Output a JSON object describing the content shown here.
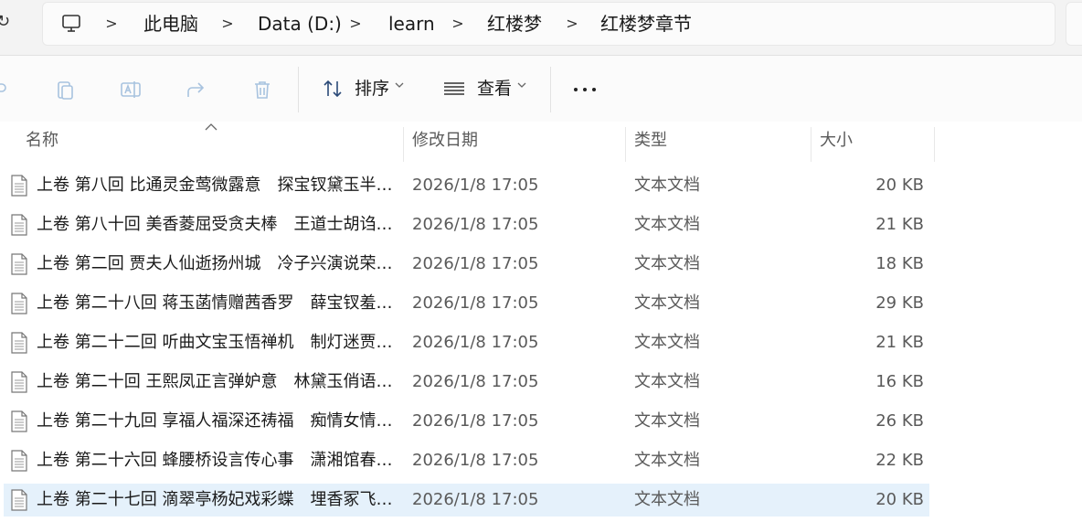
{
  "address_bar": {
    "breadcrumbs": [
      "此电脑",
      "Data (D:)",
      "learn",
      "红楼梦",
      "红楼梦章节"
    ]
  },
  "toolbar": {
    "sort_label": "排序",
    "view_label": "查看"
  },
  "columns": {
    "name": "名称",
    "date": "修改日期",
    "type": "类型",
    "size": "大小"
  },
  "files": [
    {
      "name": "上卷 第八回 比通灵金莺微露意　探宝钗黛玉半含酸.txt",
      "display_name": "上卷 第八回 比通灵金莺微露意　探宝钗黛玉半…",
      "date": "2026/1/8 17:05",
      "type": "文本文档",
      "size": "20 KB"
    },
    {
      "name": "上卷 第八十回",
      "display_name": "上卷 第八十回  美香菱屈受贪夫棒　王道士胡诌…",
      "date": "2026/1/8 17:05",
      "type": "文本文档",
      "size": "21 KB"
    },
    {
      "name": "上卷 第二回",
      "display_name": "上卷 第二回  贾夫人仙逝扬州城　冷子兴演说荣…",
      "date": "2026/1/8 17:05",
      "type": "文本文档",
      "size": "18 KB"
    },
    {
      "name": "上卷 第二十八回",
      "display_name": "上卷 第二十八回  蒋玉菡情赠茜香罗　薛宝钗羞…",
      "date": "2026/1/8 17:05",
      "type": "文本文档",
      "size": "29 KB"
    },
    {
      "name": "上卷 第二十二回",
      "display_name": "上卷 第二十二回  听曲文宝玉悟禅机　制灯迷贾…",
      "date": "2026/1/8 17:05",
      "type": "文本文档",
      "size": "21 KB"
    },
    {
      "name": "上卷 第二十回",
      "display_name": "上卷 第二十回  王熙凤正言弹妒意　林黛玉俏语…",
      "date": "2026/1/8 17:05",
      "type": "文本文档",
      "size": "16 KB"
    },
    {
      "name": "上卷 第二十九回",
      "display_name": "上卷 第二十九回  享福人福深还祷福　痴情女情…",
      "date": "2026/1/8 17:05",
      "type": "文本文档",
      "size": "26 KB"
    },
    {
      "name": "上卷 第二十六回",
      "display_name": "上卷 第二十六回  蜂腰桥设言传心事　潇湘馆春…",
      "date": "2026/1/8 17:05",
      "type": "文本文档",
      "size": "22 KB"
    },
    {
      "name": "上卷 第二十七回",
      "display_name": "上卷 第二十七回  滴翠亭杨妃戏彩蝶　埋香冢飞…",
      "date": "2026/1/8 17:05",
      "type": "文本文档",
      "size": "20 KB",
      "selected": true
    }
  ],
  "colors": {
    "selection": "#e5f1fb",
    "background": "#f3f3f3",
    "list_background": "#ffffff",
    "secondary_text": "#5a5a5a"
  }
}
